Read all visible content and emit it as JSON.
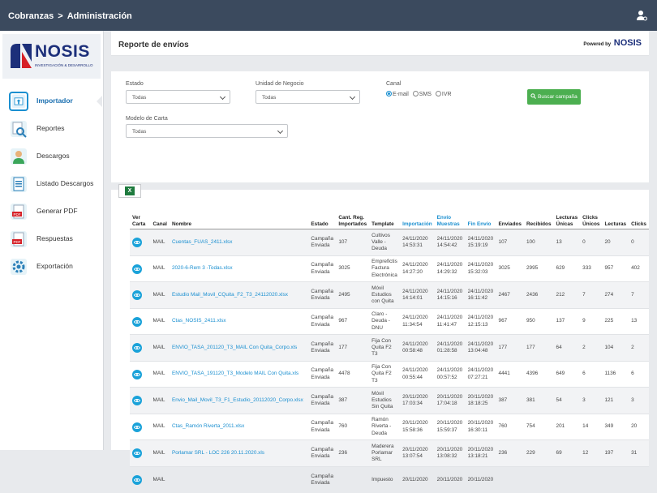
{
  "topbar": {
    "crumb1": "Cobranzas",
    "sep": ">",
    "crumb2": "Administración"
  },
  "logo": {
    "name": "NOSIS",
    "sub": "INVESTIGACIÓN & DESARROLLO"
  },
  "menu": [
    {
      "label": "Importador",
      "icon": "upload-icon"
    },
    {
      "label": "Reportes",
      "icon": "report-icon"
    },
    {
      "label": "Descargos",
      "icon": "person-icon"
    },
    {
      "label": "Listado Descargos",
      "icon": "list-icon"
    },
    {
      "label": "Generar PDF",
      "icon": "pdf-icon"
    },
    {
      "label": "Respuestas",
      "icon": "pdf-icon"
    },
    {
      "label": "Exportación",
      "icon": "gear-icon"
    }
  ],
  "header": {
    "title": "Reporte de envíos",
    "powered_by": "Powered by",
    "powered_name": "NOSIS"
  },
  "filters": {
    "estado_label": "Estado",
    "estado_value": "Todas",
    "unidad_label": "Unidad de Negocio",
    "unidad_value": "Todas",
    "canal_label": "Canal",
    "canal_options": [
      "E-mail",
      "SMS",
      "IVR"
    ],
    "modelo_label": "Modelo de Carta",
    "modelo_value": "Todas",
    "search_button": "Buscar campaña"
  },
  "table": {
    "headers": [
      "Ver Carta",
      "Canal",
      "Nombre",
      "Estado",
      "Cant. Reg. Importados",
      "Template",
      "Importación",
      "Envío Muestras",
      "Fin Envío",
      "Enviados",
      "Recibidos",
      "Lecturas Únicas",
      "Clicks Únicos",
      "Lecturas",
      "Clicks"
    ],
    "rows": [
      [
        "MAIL",
        "Cuentas_FUAS_2411.xlsx",
        "Campaña Enviada",
        "107",
        "Cultivos Valle - Deuda",
        "24/11/2020 14:53:31",
        "24/11/2020 14:54:42",
        "24/11/2020 15:19:19",
        "107",
        "100",
        "13",
        "0",
        "20",
        "0"
      ],
      [
        "MAIL",
        "2020-6-Rem 3 -Todas.xlsx",
        "Campaña Enviada",
        "3025",
        "Emprefictis Factura Electrónica",
        "24/11/2020 14:27:20",
        "24/11/2020 14:29:32",
        "24/11/2020 15:32:03",
        "3025",
        "2995",
        "629",
        "333",
        "957",
        "402"
      ],
      [
        "MAIL",
        "Estudio Mail_Movil_CQuita_F2_T3_24112020.xlsx",
        "Campaña Enviada",
        "2495",
        "Móvil Estudios con Quita",
        "24/11/2020 14:14:01",
        "24/11/2020 14:15:16",
        "24/11/2020 16:11:42",
        "2467",
        "2436",
        "212",
        "7",
        "274",
        "7"
      ],
      [
        "MAIL",
        "Ctas_NOSIS_2411.xlsx",
        "Campaña Enviada",
        "967",
        "Claro - Deuda - DNU",
        "24/11/2020 11:34:54",
        "24/11/2020 11:41:47",
        "24/11/2020 12:15:13",
        "967",
        "950",
        "137",
        "9",
        "225",
        "13"
      ],
      [
        "MAIL",
        "ENVIO_TASA_201120_T3_MAIL Con Quita_Corpo.xls",
        "Campaña Enviada",
        "177",
        "Fija Con Quita F2 T3",
        "24/11/2020 00:58:48",
        "24/11/2020 01:28:58",
        "24/11/2020 13:04:48",
        "177",
        "177",
        "64",
        "2",
        "104",
        "2"
      ],
      [
        "MAIL",
        "ENVIO_TASA_191120_T3_Modelo MAIL Con Quita.xls",
        "Campaña Enviada",
        "4478",
        "Fija Con Quita F2 T3",
        "24/11/2020 00:55:44",
        "24/11/2020 00:57:52",
        "24/11/2020 07:27:21",
        "4441",
        "4396",
        "649",
        "6",
        "1136",
        "6"
      ],
      [
        "MAIL",
        "Envio_Mail_Movil_T3_F1_Estudio_20112020_Corpo.xlsx",
        "Campaña Enviada",
        "387",
        "Móvil Estudios Sin Quita",
        "20/11/2020 17:03:34",
        "20/11/2020 17:04:18",
        "20/11/2020 18:18:25",
        "387",
        "381",
        "54",
        "3",
        "121",
        "3"
      ],
      [
        "MAIL",
        "Ctas_Ramón Riverta_2011.xlsx",
        "Campaña Enviada",
        "760",
        "Ramón Riverta - Deuda",
        "20/11/2020 15:58:36",
        "20/11/2020 15:59:37",
        "20/11/2020 16:30:11",
        "760",
        "754",
        "201",
        "14",
        "349",
        "20"
      ],
      [
        "MAIL",
        "Porlamar SRL - LOC 226 20.11.2020.xls",
        "Campaña Enviada",
        "236",
        "Maderera Porlamar SRL",
        "20/11/2020 13:07:54",
        "20/11/2020 13:08:32",
        "20/11/2020 13:18:21",
        "236",
        "229",
        "69",
        "12",
        "197",
        "31"
      ],
      [
        "MAIL",
        "",
        "Campaña Enviada",
        "",
        "Impuesto",
        "20/11/2020",
        "20/11/2020",
        "20/11/2020",
        "",
        "",
        "",
        "",
        "",
        ""
      ]
    ]
  }
}
